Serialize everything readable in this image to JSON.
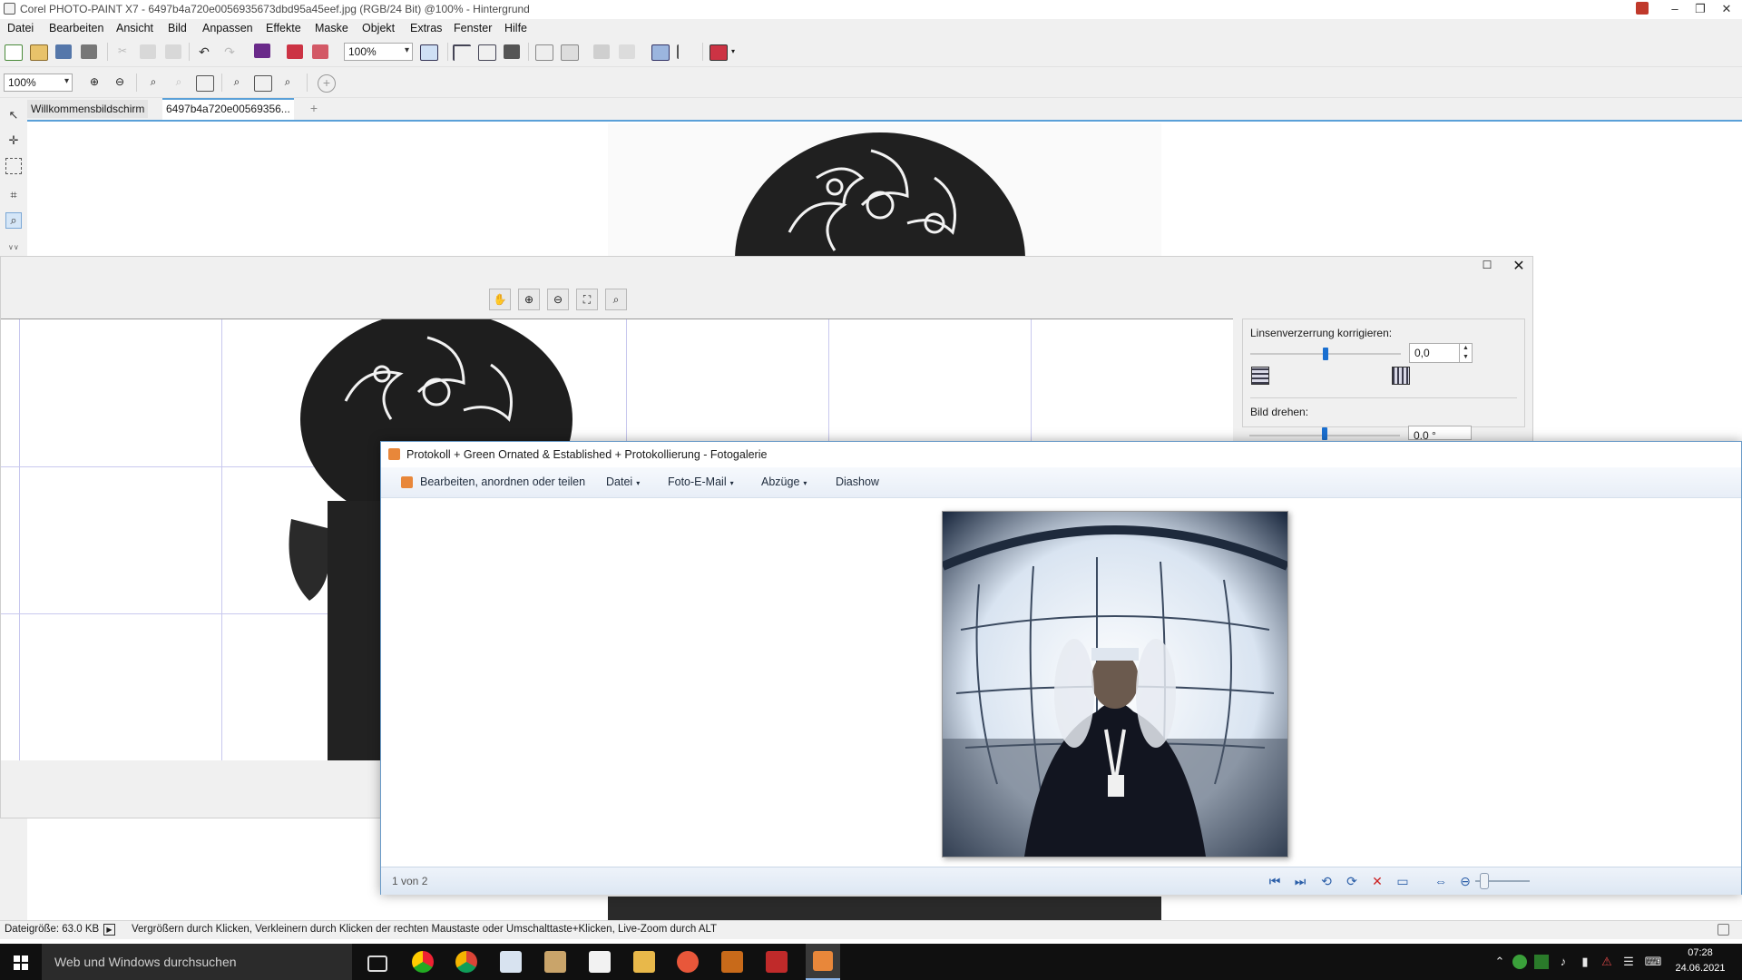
{
  "app": {
    "title": "Corel PHOTO-PAINT X7 - 6497b4a720e0056935673dbd95a45eef.jpg (RGB/24 Bit) @100% - Hintergrund",
    "menu": [
      "Datei",
      "Bearbeiten",
      "Ansicht",
      "Bild",
      "Anpassen",
      "Effekte",
      "Maske",
      "Objekt",
      "Extras",
      "Fenster",
      "Hilfe"
    ],
    "zoom_top": "100%",
    "zoom_left": "100%",
    "tabs": [
      "Willkommensbildschirm",
      "6497b4a720e00569356..."
    ]
  },
  "lens_dialog": {
    "distortion_label": "Linsenverzerrung korrigieren:",
    "distortion_value": "0,0",
    "distortion_level": 0.5,
    "rotate_label": "Bild drehen:",
    "rotate_value": "0,0 °",
    "rotate_level": 0.5
  },
  "gallery": {
    "title": "Protokoll + Green Ornated & Established + Protokollierung - Fotogalerie",
    "menu": {
      "edit": "Bearbeiten, anordnen oder teilen",
      "file": "Datei",
      "email": "Foto-E-Mail",
      "prints": "Abzüge",
      "slideshow": "Diashow"
    },
    "counter": "1 von 2"
  },
  "status": {
    "filesize": "Dateigröße: 63.0 KB",
    "hint": "Vergrößern durch Klicken, Verkleinern durch Klicken der rechten Maustaste oder Umschalttaste+Klicken, Live-Zoom durch ALT"
  },
  "taskbar": {
    "search_placeholder": "Web und Windows durchsuchen",
    "time": "07:28",
    "date": "24.06.2021"
  },
  "colors": {
    "accent": "#1a6fd0",
    "taskbar": "#101010",
    "gallery_border": "#6a9bc8"
  }
}
